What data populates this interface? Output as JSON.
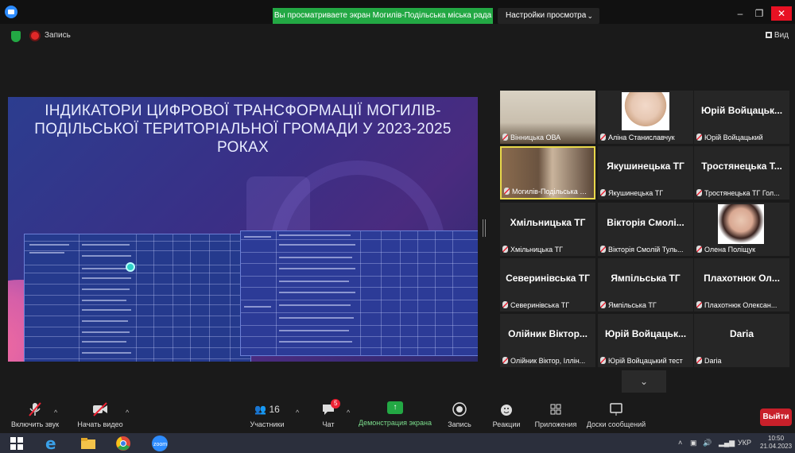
{
  "top_bar": {
    "share_banner": "Вы просматриваете экран Могилів-Подільська міська рада",
    "view_options": "Настройки просмотра",
    "window_controls": [
      "minimize",
      "restore",
      "close"
    ]
  },
  "meeting_info": {
    "recording_label": "Запись",
    "view_label": "Вид"
  },
  "shared_slide": {
    "title": "ІНДИКАТОРИ ЦИФРОВОЇ ТРАНСФОРМАЦІЇ МОГИЛІВ-ПОДІЛЬСЬКОЇ ТЕРИТОРІАЛЬНОЇ ГРОМАДИ У 2023-2025 РОКАХ",
    "colors": {
      "background": "#3a2f86",
      "table": "#2c3b97",
      "accent": "#f06aa0"
    }
  },
  "participants": [
    {
      "name_label": "Вінницька ОВА",
      "display": "",
      "has_video": true
    },
    {
      "name_label": "Аліна Станиславчук",
      "display": "",
      "has_video": true
    },
    {
      "name_label": "Юрій Войцацький",
      "display": "Юрій Войцацьк...",
      "has_video": false
    },
    {
      "name_label": "Могилів-Подільська міс...",
      "display": "",
      "has_video": true,
      "active": true
    },
    {
      "name_label": "Якушинецька ТГ",
      "display": "Якушинецька ТГ",
      "has_video": false
    },
    {
      "name_label": "Тростянецька ТГ Гол...",
      "display": "Тростянецька Т...",
      "has_video": false
    },
    {
      "name_label": "Хмільницька ТГ",
      "display": "Хмільницька ТГ",
      "has_video": false
    },
    {
      "name_label": "Вікторія Смолій Туль...",
      "display": "Вікторія Смолі...",
      "has_video": false
    },
    {
      "name_label": "Олена Поліщук",
      "display": "",
      "has_video": true
    },
    {
      "name_label": "Северинівська ТГ",
      "display": "Северинівська ТГ",
      "has_video": false
    },
    {
      "name_label": "Ямпільська ТГ",
      "display": "Ямпільська ТГ",
      "has_video": false
    },
    {
      "name_label": "Плахотнюк Олексан...",
      "display": "Плахотнюк Ол...",
      "has_video": false
    },
    {
      "name_label": "Олійник Віктор, Іллін...",
      "display": "Олійник Віктор...",
      "has_video": false
    },
    {
      "name_label": "Юрій Войцацький тест",
      "display": "Юрій Войцацьк...",
      "has_video": false
    },
    {
      "name_label": "Daria",
      "display": "Daria",
      "has_video": false
    }
  ],
  "toolbar": {
    "unmute": "Включить звук",
    "start_video": "Начать видео",
    "participants": "Участники",
    "participants_count": "16",
    "chat": "Чат",
    "chat_badge": "5",
    "share_screen": "Демонстрация экрана",
    "record": "Запись",
    "reactions": "Реакции",
    "apps": "Приложения",
    "whiteboards": "Доски сообщений",
    "leave": "Выйти"
  },
  "taskbar": {
    "language": "УКР",
    "time": "10:50",
    "date": "21.04.2023",
    "apps": [
      "start",
      "edge",
      "file-explorer",
      "chrome",
      "zoom"
    ]
  }
}
